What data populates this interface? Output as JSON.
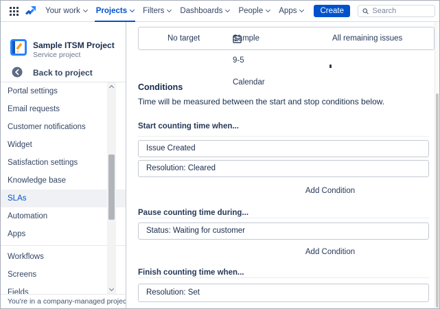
{
  "nav": {
    "items": [
      {
        "label": "Your work"
      },
      {
        "label": "Projects"
      },
      {
        "label": "Filters"
      },
      {
        "label": "Dashboards"
      },
      {
        "label": "People"
      },
      {
        "label": "Apps"
      }
    ],
    "active_item": "Projects",
    "create_label": "Create",
    "search_placeholder": "Search"
  },
  "sidebar": {
    "project_name": "Sample ITSM Project",
    "project_type": "Service project",
    "back_label": "Back to project",
    "items": [
      {
        "label": "Portal settings"
      },
      {
        "label": "Email requests"
      },
      {
        "label": "Customer notifications"
      },
      {
        "label": "Widget"
      },
      {
        "label": "Satisfaction settings"
      },
      {
        "label": "Knowledge base"
      },
      {
        "label": "SLAs",
        "selected": true
      },
      {
        "label": "Automation"
      },
      {
        "label": "Apps"
      },
      {
        "label": "Workflows"
      },
      {
        "label": "Screens"
      },
      {
        "label": "Fields"
      }
    ],
    "footer": "You're in a company-managed project"
  },
  "main": {
    "summary_row": {
      "target": "No target",
      "calendar": "Sample 9-5 Calendar",
      "scope": "All remaining issues"
    },
    "conditions": {
      "title": "Conditions",
      "description": "Time will be measured between the start and stop conditions below.",
      "sections": [
        {
          "label": "Start counting time when...",
          "rows": [
            "Issue Created",
            "Resolution: Cleared"
          ],
          "add_label": "Add Condition"
        },
        {
          "label": "Pause counting time during...",
          "rows": [
            "Status: Waiting for customer"
          ],
          "add_label": "Add Condition"
        },
        {
          "label": "Finish counting time when...",
          "rows": [
            "Resolution: Set"
          ]
        }
      ]
    }
  },
  "colors": {
    "accent_blue": "#0052cc",
    "text_dark": "#172b4d",
    "text_gray": "#6b778c",
    "border": "#c3c9d1",
    "selected_bg": "#f0f1f4"
  }
}
